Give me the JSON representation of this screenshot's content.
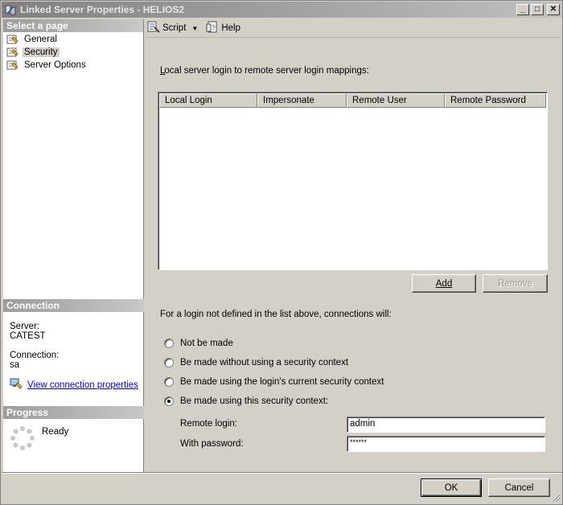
{
  "window": {
    "title": "Linked Server Properties - HELIOS2",
    "minimize": "_",
    "maximize": "□",
    "close": "✕"
  },
  "left": {
    "select_page_header": "Select a page",
    "pages": [
      {
        "label": "General"
      },
      {
        "label": "Security",
        "selected": true
      },
      {
        "label": "Server Options"
      }
    ],
    "connection_header": "Connection",
    "server_label": "Server:",
    "server_value": "CATEST",
    "connection_label": "Connection:",
    "connection_value": "sa",
    "view_connection_properties": "View connection properties",
    "progress_header": "Progress",
    "progress_status": "Ready"
  },
  "toolbar": {
    "script_label": "Script",
    "help_label": "Help"
  },
  "security": {
    "mappings_label": "Local server login to remote server login mappings:",
    "columns": [
      "Local Login",
      "Impersonate",
      "Remote User",
      "Remote Password"
    ],
    "add_label": "Add",
    "remove_label": "Remove",
    "connections_label": "For a login not defined in the list above, connections will:",
    "options": [
      {
        "label": "Not be made",
        "checked": false
      },
      {
        "label": "Be made without using a security context",
        "checked": false
      },
      {
        "label": "Be made using the login's current security context",
        "checked": false
      },
      {
        "label": "Be made using this security context:",
        "checked": true
      }
    ],
    "remote_login_label": "Remote login:",
    "remote_login_value": "admin",
    "password_label": "With password:",
    "password_value": "******"
  },
  "footer": {
    "ok_label": "OK",
    "cancel_label": "Cancel"
  }
}
